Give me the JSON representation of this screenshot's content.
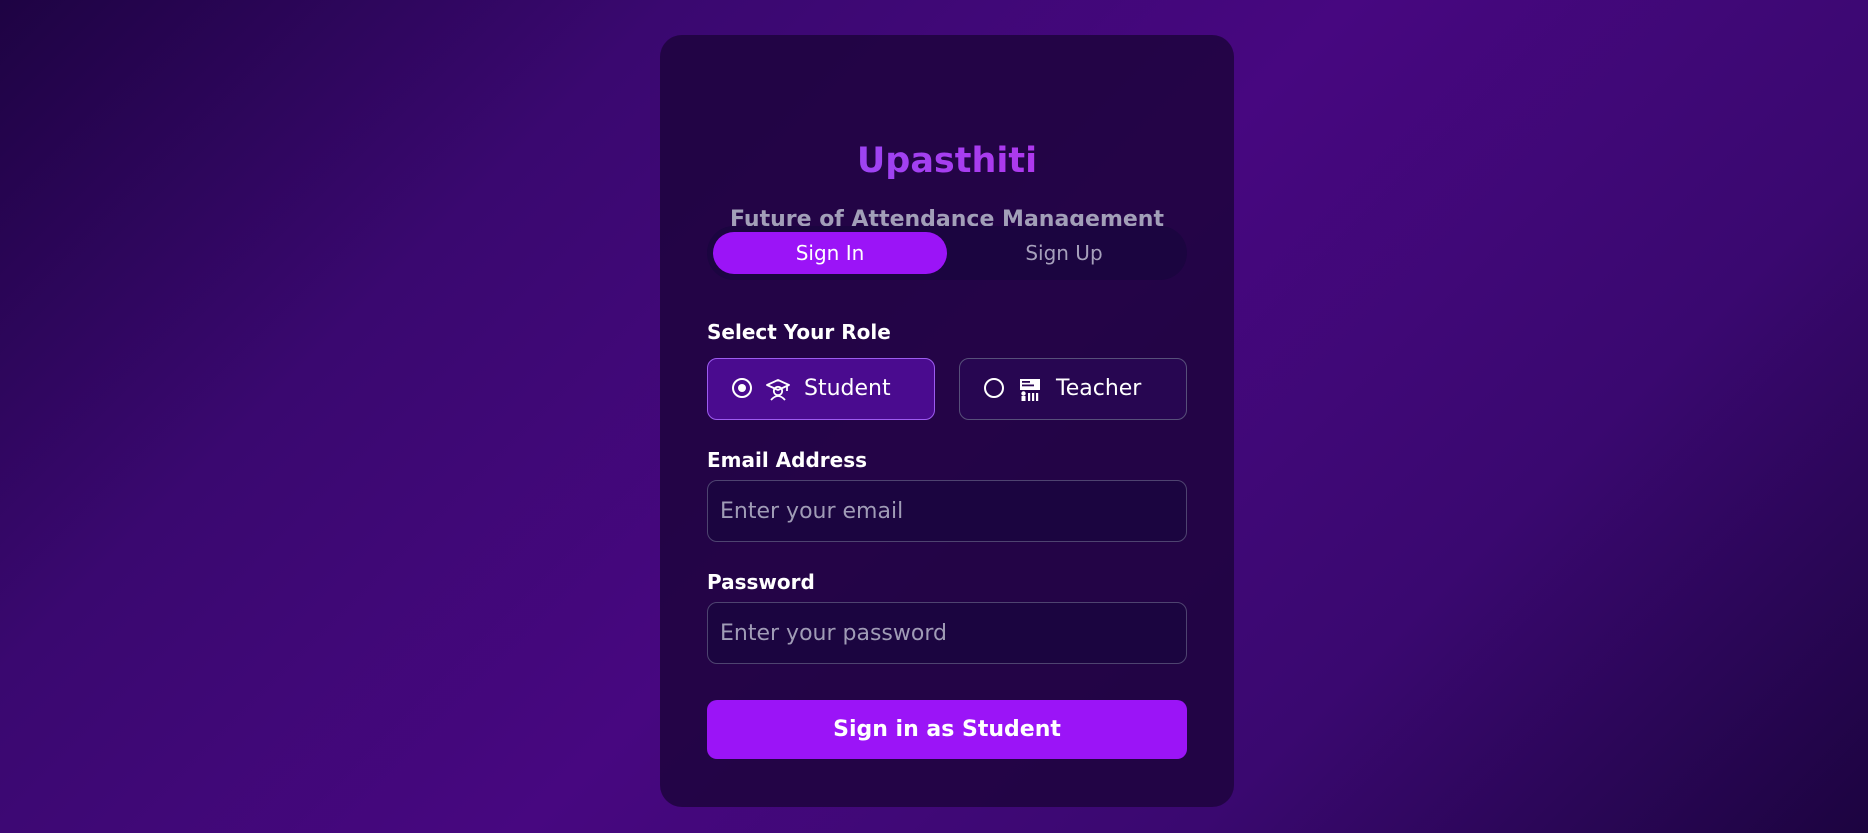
{
  "app": {
    "title": "Upasthiti",
    "subtitle": "Future of Attendance Management"
  },
  "auth_tabs": {
    "signin_label": "Sign In",
    "signup_label": "Sign Up",
    "active": "Sign In"
  },
  "role": {
    "label": "Select Your Role",
    "selected": "Student",
    "options": [
      {
        "label": "Student",
        "icon": "graduation-cap-icon",
        "selected": true
      },
      {
        "label": "Teacher",
        "icon": "teacher-at-board-icon",
        "selected": false
      }
    ]
  },
  "email": {
    "label": "Email Address",
    "placeholder": "Enter your email",
    "value": ""
  },
  "password": {
    "label": "Password",
    "placeholder": "Enter your password",
    "value": ""
  },
  "submit": {
    "label": "Sign in as Student"
  },
  "colors": {
    "accent": "#9b14f7",
    "card": "#1e043e",
    "title_gradient_start": "#8b50f8",
    "title_gradient_end": "#c02ce8"
  }
}
